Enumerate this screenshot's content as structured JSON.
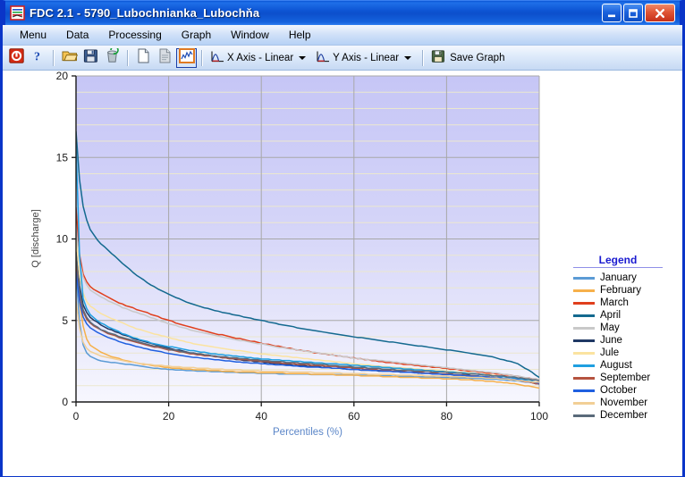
{
  "window": {
    "title": "FDC 2.1 - 5790_Lubochnianka_Lubochňa",
    "icon": "app-chart-icon",
    "buttons": {
      "minimize": "minimize-button",
      "maximize": "maximize-button",
      "close": "close-button"
    }
  },
  "menubar": {
    "items": [
      {
        "label": "Menu"
      },
      {
        "label": "Data"
      },
      {
        "label": "Processing"
      },
      {
        "label": "Graph"
      },
      {
        "label": "Window"
      },
      {
        "label": "Help"
      }
    ]
  },
  "toolbar": {
    "buttons": [
      {
        "name": "stop-icon",
        "tooltip": "Stop"
      },
      {
        "name": "help-icon",
        "tooltip": "Help"
      },
      {
        "name": "open-folder-icon",
        "tooltip": "Open"
      },
      {
        "name": "save-disk-icon",
        "tooltip": "Save"
      },
      {
        "name": "recycle-bin-icon",
        "tooltip": "Delete"
      },
      {
        "name": "new-document-icon",
        "tooltip": "New"
      },
      {
        "name": "copy-document-icon",
        "tooltip": "Copy"
      },
      {
        "name": "chart-view-icon",
        "tooltip": "Graph",
        "selected": true
      }
    ],
    "x_axis_label": "X Axis - Linear",
    "y_axis_label": "Y Axis - Linear",
    "save_graph_label": "Save Graph"
  },
  "chart_data": {
    "type": "line",
    "title": "",
    "xlabel": "Percentiles (%)",
    "ylabel": "Q [discharge]",
    "xlim": [
      0,
      100
    ],
    "ylim": [
      0,
      20
    ],
    "xticks": [
      0,
      20,
      40,
      60,
      80,
      100
    ],
    "yticks": [
      0,
      5,
      10,
      15,
      20
    ],
    "grid": true,
    "minor_grid": true,
    "legend_position": "right",
    "legend_title": "Legend",
    "x": [
      0,
      1,
      2,
      3,
      5,
      7,
      10,
      13,
      16,
      20,
      25,
      30,
      35,
      40,
      45,
      50,
      55,
      60,
      65,
      70,
      75,
      80,
      85,
      90,
      95,
      98,
      100
    ],
    "series": [
      {
        "name": "January",
        "color": "#5b9bd5",
        "values": [
          7.9,
          4.0,
          3.1,
          2.8,
          2.55,
          2.45,
          2.35,
          2.25,
          2.1,
          2.0,
          1.92,
          1.86,
          1.8,
          1.76,
          1.72,
          1.7,
          1.68,
          1.66,
          1.62,
          1.58,
          1.54,
          1.5,
          1.45,
          1.4,
          1.3,
          1.2,
          1.1
        ]
      },
      {
        "name": "February",
        "color": "#f6b04a",
        "values": [
          8.3,
          5.4,
          4.0,
          3.5,
          3.1,
          2.85,
          2.6,
          2.4,
          2.25,
          2.1,
          2.0,
          1.92,
          1.85,
          1.8,
          1.76,
          1.72,
          1.68,
          1.63,
          1.58,
          1.52,
          1.47,
          1.42,
          1.35,
          1.25,
          1.1,
          0.95,
          0.85
        ]
      },
      {
        "name": "March",
        "color": "#e03f1c",
        "values": [
          11.9,
          8.2,
          7.5,
          7.1,
          6.7,
          6.4,
          6.0,
          5.7,
          5.4,
          5.0,
          4.55,
          4.2,
          3.9,
          3.6,
          3.35,
          3.1,
          2.9,
          2.7,
          2.5,
          2.35,
          2.2,
          2.05,
          1.9,
          1.75,
          1.6,
          1.45,
          1.35
        ]
      },
      {
        "name": "April",
        "color": "#13698f",
        "values": [
          16.6,
          12.7,
          11.4,
          10.6,
          9.8,
          9.3,
          8.5,
          7.8,
          7.2,
          6.6,
          6.0,
          5.6,
          5.3,
          5.0,
          4.7,
          4.45,
          4.2,
          4.0,
          3.8,
          3.6,
          3.4,
          3.2,
          3.0,
          2.75,
          2.4,
          1.9,
          1.5
        ]
      },
      {
        "name": "May",
        "color": "#c9c9c9",
        "values": [
          10.5,
          8.1,
          7.3,
          6.9,
          6.5,
          6.2,
          5.8,
          5.5,
          5.2,
          4.8,
          4.4,
          4.1,
          3.8,
          3.55,
          3.3,
          3.1,
          2.9,
          2.7,
          2.55,
          2.4,
          2.25,
          2.1,
          1.95,
          1.8,
          1.6,
          1.45,
          1.35
        ]
      },
      {
        "name": "June",
        "color": "#1f3864",
        "values": [
          9.6,
          6.4,
          5.6,
          5.2,
          4.8,
          4.5,
          4.15,
          3.85,
          3.6,
          3.3,
          3.0,
          2.8,
          2.6,
          2.45,
          2.3,
          2.2,
          2.1,
          2.0,
          1.92,
          1.85,
          1.78,
          1.7,
          1.62,
          1.5,
          1.35,
          1.2,
          1.1
        ]
      },
      {
        "name": "Jule",
        "color": "#fbe3a0",
        "values": [
          9.9,
          7.1,
          6.3,
          5.9,
          5.5,
          5.2,
          4.85,
          4.5,
          4.25,
          3.95,
          3.6,
          3.35,
          3.15,
          2.95,
          2.8,
          2.65,
          2.5,
          2.35,
          2.2,
          2.1,
          2.0,
          1.9,
          1.78,
          1.65,
          1.45,
          1.3,
          1.2
        ]
      },
      {
        "name": "August",
        "color": "#1f9fe0",
        "values": [
          15.8,
          6.9,
          5.9,
          5.4,
          4.9,
          4.6,
          4.2,
          3.9,
          3.65,
          3.4,
          3.15,
          2.95,
          2.8,
          2.65,
          2.55,
          2.45,
          2.35,
          2.25,
          2.15,
          2.05,
          1.95,
          1.85,
          1.75,
          1.62,
          1.45,
          1.3,
          1.2
        ]
      },
      {
        "name": "September",
        "color": "#b5533f",
        "values": [
          8.6,
          5.9,
          5.2,
          4.85,
          4.45,
          4.2,
          3.9,
          3.65,
          3.45,
          3.2,
          2.95,
          2.78,
          2.62,
          2.5,
          2.38,
          2.28,
          2.18,
          2.08,
          1.98,
          1.88,
          1.8,
          1.7,
          1.6,
          1.5,
          1.35,
          1.2,
          1.1
        ]
      },
      {
        "name": "October",
        "color": "#1f5fe0",
        "values": [
          8.0,
          5.6,
          4.9,
          4.55,
          4.2,
          3.95,
          3.65,
          3.4,
          3.2,
          2.98,
          2.75,
          2.6,
          2.45,
          2.35,
          2.25,
          2.15,
          2.08,
          2.0,
          1.92,
          1.84,
          1.76,
          1.68,
          1.6,
          1.5,
          1.38,
          1.25,
          1.15
        ]
      },
      {
        "name": "November",
        "color": "#f2cf96",
        "values": [
          6.2,
          4.0,
          3.4,
          3.1,
          2.85,
          2.7,
          2.52,
          2.4,
          2.3,
          2.2,
          2.1,
          2.02,
          1.96,
          1.9,
          1.86,
          1.82,
          1.78,
          1.74,
          1.7,
          1.66,
          1.62,
          1.58,
          1.52,
          1.45,
          1.35,
          1.25,
          1.2
        ]
      },
      {
        "name": "December",
        "color": "#5a6a7a",
        "values": [
          9.2,
          6.1,
          5.3,
          4.9,
          4.5,
          4.25,
          3.95,
          3.7,
          3.5,
          3.25,
          3.0,
          2.82,
          2.68,
          2.55,
          2.45,
          2.35,
          2.25,
          2.15,
          2.05,
          1.96,
          1.88,
          1.8,
          1.72,
          1.62,
          1.5,
          1.38,
          1.3
        ]
      }
    ]
  }
}
